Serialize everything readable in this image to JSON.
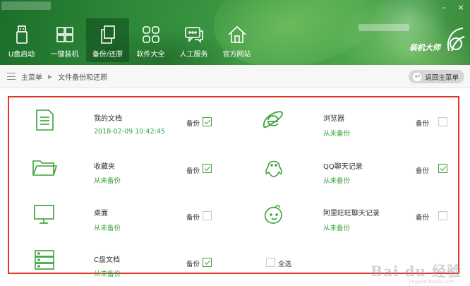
{
  "window": {
    "minimize": "–",
    "close": "×"
  },
  "nav": [
    {
      "label": "U盘启动",
      "icon": "usb-icon"
    },
    {
      "label": "一键装机",
      "icon": "windows-icon"
    },
    {
      "label": "备份/还原",
      "icon": "copy-icon",
      "active": true
    },
    {
      "label": "软件大全",
      "icon": "grid-icon"
    },
    {
      "label": "人工服务",
      "icon": "chat-icon"
    },
    {
      "label": "官方网站",
      "icon": "home-icon"
    }
  ],
  "brand": {
    "name": "装机大师"
  },
  "breadcrumb": {
    "root": "主菜单",
    "current": "文件备份和还原",
    "back": "返回主菜单"
  },
  "items": [
    {
      "name": "我的文档",
      "status": "2018-02-09 10:42:45",
      "backup_label": "备份",
      "checked": true,
      "icon": "document-icon"
    },
    {
      "name": "浏览器",
      "status": "从未备份",
      "backup_label": "备份",
      "checked": false,
      "icon": "ie-browser-icon"
    },
    {
      "name": "收藏夹",
      "status": "从未备份",
      "backup_label": "备份",
      "checked": true,
      "icon": "folder-icon"
    },
    {
      "name": "QQ聊天记录",
      "status": "从未备份",
      "backup_label": "备份",
      "checked": true,
      "icon": "qq-icon"
    },
    {
      "name": "桌面",
      "status": "从未备份",
      "backup_label": "备份",
      "checked": false,
      "icon": "monitor-icon"
    },
    {
      "name": "阿里旺旺聊天记录",
      "status": "从未备份",
      "backup_label": "备份",
      "checked": false,
      "icon": "wangwang-icon"
    },
    {
      "name": "C盘文档",
      "status": "从未备份",
      "backup_label": "备份",
      "checked": true,
      "icon": "server-icon"
    }
  ],
  "select_all": {
    "label": "全选",
    "checked": false
  },
  "watermark": {
    "text": "Bai du 经验",
    "sub": "jingyan.baidu.com"
  },
  "colors": {
    "accent_green": "#3aa23a",
    "highlight_red": "#e0352b",
    "banner_green": "#2f8b3a"
  }
}
